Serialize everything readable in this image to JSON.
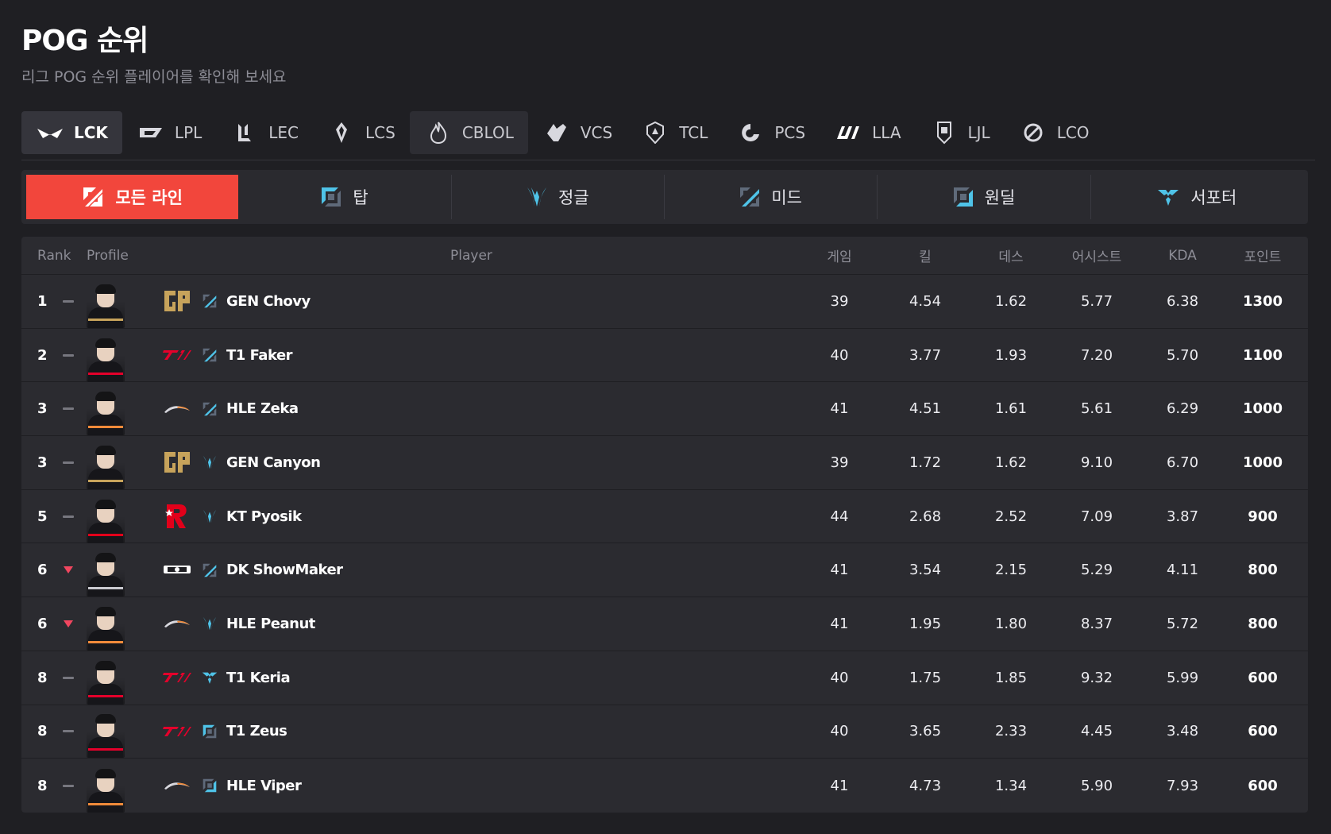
{
  "header": {
    "title": "POG 순위",
    "subtitle": "리그 POG 순위 플레이어를 확인해 보세요"
  },
  "leagues": [
    {
      "label": "LCK",
      "icon": "lck-logo-icon",
      "active": true
    },
    {
      "label": "LPL",
      "icon": "lpl-logo-icon"
    },
    {
      "label": "LEC",
      "icon": "lec-logo-icon"
    },
    {
      "label": "LCS",
      "icon": "lcs-logo-icon"
    },
    {
      "label": "CBLOL",
      "icon": "cblol-logo-icon",
      "hover": true
    },
    {
      "label": "VCS",
      "icon": "vcs-logo-icon"
    },
    {
      "label": "TCL",
      "icon": "tcl-logo-icon"
    },
    {
      "label": "PCS",
      "icon": "pcs-logo-icon"
    },
    {
      "label": "LLA",
      "icon": "lla-logo-icon"
    },
    {
      "label": "LJL",
      "icon": "ljl-logo-icon"
    },
    {
      "label": "LCO",
      "icon": "lco-logo-icon"
    }
  ],
  "lanes": [
    {
      "label": "모든 라인",
      "icon": "all-lanes-icon",
      "active": true
    },
    {
      "label": "탑",
      "icon": "top-lane-icon"
    },
    {
      "label": "정글",
      "icon": "jungle-icon"
    },
    {
      "label": "미드",
      "icon": "mid-lane-icon"
    },
    {
      "label": "원딜",
      "icon": "bot-lane-icon"
    },
    {
      "label": "서포터",
      "icon": "support-icon"
    }
  ],
  "table": {
    "headers": {
      "rank": "Rank",
      "profile": "Profile",
      "player": "Player",
      "games": "게임",
      "kills": "킬",
      "deaths": "데스",
      "assists": "어시스트",
      "kda": "KDA",
      "points": "포인트"
    },
    "rows": [
      {
        "rank": "1",
        "trend": "flat",
        "team": "GEN",
        "position": "mid",
        "player": "GEN Chovy",
        "games": "39",
        "kills": "4.54",
        "deaths": "1.62",
        "assists": "5.77",
        "kda": "6.38",
        "points": "1300"
      },
      {
        "rank": "2",
        "trend": "flat",
        "team": "T1",
        "position": "mid",
        "player": "T1 Faker",
        "games": "40",
        "kills": "3.77",
        "deaths": "1.93",
        "assists": "7.20",
        "kda": "5.70",
        "points": "1100"
      },
      {
        "rank": "3",
        "trend": "flat",
        "team": "HLE",
        "position": "mid",
        "player": "HLE Zeka",
        "games": "41",
        "kills": "4.51",
        "deaths": "1.61",
        "assists": "5.61",
        "kda": "6.29",
        "points": "1000"
      },
      {
        "rank": "3",
        "trend": "flat",
        "team": "GEN",
        "position": "jungle",
        "player": "GEN Canyon",
        "games": "39",
        "kills": "1.72",
        "deaths": "1.62",
        "assists": "9.10",
        "kda": "6.70",
        "points": "1000"
      },
      {
        "rank": "5",
        "trend": "flat",
        "team": "KT",
        "position": "jungle",
        "player": "KT Pyosik",
        "games": "44",
        "kills": "2.68",
        "deaths": "2.52",
        "assists": "7.09",
        "kda": "3.87",
        "points": "900"
      },
      {
        "rank": "6",
        "trend": "down",
        "team": "DK",
        "position": "mid",
        "player": "DK ShowMaker",
        "games": "41",
        "kills": "3.54",
        "deaths": "2.15",
        "assists": "5.29",
        "kda": "4.11",
        "points": "800"
      },
      {
        "rank": "6",
        "trend": "down",
        "team": "HLE",
        "position": "jungle",
        "player": "HLE Peanut",
        "games": "41",
        "kills": "1.95",
        "deaths": "1.80",
        "assists": "8.37",
        "kda": "5.72",
        "points": "800"
      },
      {
        "rank": "8",
        "trend": "flat",
        "team": "T1",
        "position": "support",
        "player": "T1 Keria",
        "games": "40",
        "kills": "1.75",
        "deaths": "1.85",
        "assists": "9.32",
        "kda": "5.99",
        "points": "600"
      },
      {
        "rank": "8",
        "trend": "flat",
        "team": "T1",
        "position": "top",
        "player": "T1 Zeus",
        "games": "40",
        "kills": "3.65",
        "deaths": "2.33",
        "assists": "4.45",
        "kda": "3.48",
        "points": "600"
      },
      {
        "rank": "8",
        "trend": "flat",
        "team": "HLE",
        "position": "bot",
        "player": "HLE Viper",
        "games": "41",
        "kills": "4.73",
        "deaths": "1.34",
        "assists": "5.90",
        "kda": "7.93",
        "points": "600"
      }
    ]
  },
  "colors": {
    "background": "#1f1f23",
    "accent": "#f2463c",
    "position_icon": "#4fc3e8",
    "trend_down": "#f2465f",
    "gen": "#c7a35b",
    "t1": "#e4002b",
    "hle": "#f08a3a",
    "kt": "#e2001a"
  }
}
